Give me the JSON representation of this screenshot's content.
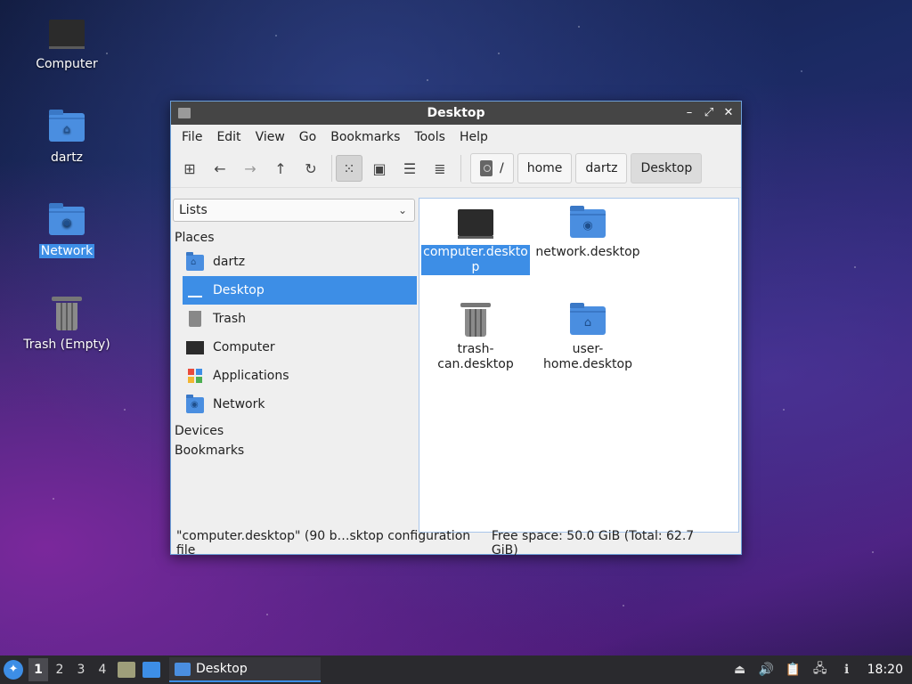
{
  "desktop": {
    "icons": [
      {
        "label": "Computer",
        "icon": "computer-icon"
      },
      {
        "label": "dartz",
        "icon": "home-folder-icon"
      },
      {
        "label": "Network",
        "icon": "network-folder-icon"
      },
      {
        "label": "Trash (Empty)",
        "icon": "trash-icon"
      }
    ]
  },
  "window": {
    "title": "Desktop",
    "controls": {
      "minimize": "–",
      "maximize": "⤢",
      "close": "✕"
    }
  },
  "menu": [
    "File",
    "Edit",
    "View",
    "Go",
    "Bookmarks",
    "Tools",
    "Help"
  ],
  "toolbar": {
    "icons": [
      "new-tab-icon",
      "back-icon",
      "forward-icon",
      "up-icon",
      "reload-icon",
      "icon-view-icon",
      "thumbnail-view-icon",
      "compact-view-icon",
      "detailed-list-icon"
    ],
    "glyphs": {
      "new_tab": "⊞",
      "back": "←",
      "forward": "→",
      "up": "↑",
      "reload": "↻",
      "icon_view": "⁙",
      "thumb_view": "▣",
      "compact_view": "☰",
      "list_view": "≣"
    }
  },
  "breadcrumbs": [
    "/",
    "home",
    "dartz",
    "Desktop"
  ],
  "side_panel": {
    "mode": "Lists",
    "sections": {
      "places": "Places",
      "devices": "Devices",
      "bookmarks": "Bookmarks"
    },
    "places": [
      {
        "label": "dartz",
        "icon": "home-folder-icon"
      },
      {
        "label": "Desktop",
        "icon": "desktop-icon",
        "selected": true
      },
      {
        "label": "Trash",
        "icon": "trash-icon"
      },
      {
        "label": "Computer",
        "icon": "computer-icon"
      },
      {
        "label": "Applications",
        "icon": "applications-icon"
      },
      {
        "label": "Network",
        "icon": "network-folder-icon"
      }
    ]
  },
  "files": [
    {
      "name": "computer.deskto\np",
      "icon": "computer-icon",
      "selected": true
    },
    {
      "name": "network.desktop",
      "icon": "network-folder-icon"
    },
    {
      "name": "trash-\ncan.desktop",
      "icon": "trash-icon"
    },
    {
      "name": "user-\nhome.desktop",
      "icon": "home-folder-icon"
    }
  ],
  "status": {
    "selection": "\"computer.desktop\" (90 b…sktop configuration file",
    "free_space": "Free space: 50.0 GiB (Total: 62.7 GiB)"
  },
  "taskbar": {
    "workspaces": [
      "1",
      "2",
      "3",
      "4"
    ],
    "active_workspace": "1",
    "task_label": "Desktop",
    "clock": "18:20"
  },
  "colors": {
    "accent": "#3d8ee6",
    "folder": "#4a8ee0",
    "titlebar": "#454545",
    "taskbar": "#2a2a2e"
  }
}
